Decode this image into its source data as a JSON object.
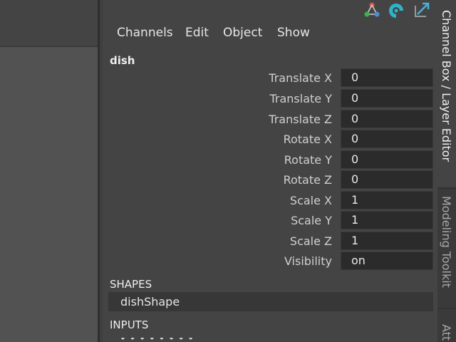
{
  "menubar": {
    "items": [
      "Channels",
      "Edit",
      "Object",
      "Show"
    ]
  },
  "toolbar": {
    "icons": [
      "attribute-editor-icon",
      "tool-settings-icon",
      "channel-box-icon"
    ]
  },
  "object": {
    "name": "dish"
  },
  "channels": [
    {
      "label": "Translate X",
      "value": "0"
    },
    {
      "label": "Translate Y",
      "value": "0"
    },
    {
      "label": "Translate Z",
      "value": "0"
    },
    {
      "label": "Rotate X",
      "value": "0"
    },
    {
      "label": "Rotate Y",
      "value": "0"
    },
    {
      "label": "Rotate Z",
      "value": "0"
    },
    {
      "label": "Scale X",
      "value": "1"
    },
    {
      "label": "Scale Y",
      "value": "1"
    },
    {
      "label": "Scale Z",
      "value": "1"
    },
    {
      "label": "Visibility",
      "value": "on"
    }
  ],
  "shapes": {
    "header": "SHAPES",
    "items": [
      "dishShape"
    ]
  },
  "inputs": {
    "header": "INPUTS"
  },
  "side_tabs": [
    "Channel Box / Layer Editor",
    "Modeling Toolkit",
    "Att"
  ],
  "colors": {
    "panel_bg": "#444444",
    "field_bg": "#2b2b2b",
    "viewport_bg": "#525252",
    "icon_red": "#d9534f",
    "icon_teal": "#2cb5c8",
    "icon_blue": "#4a8ed8"
  }
}
